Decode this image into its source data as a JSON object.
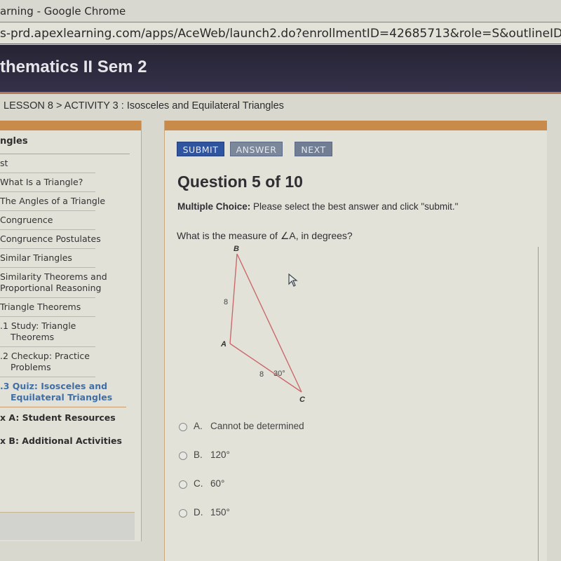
{
  "browser": {
    "window_title": "arning - Google Chrome",
    "url": "s-prd.apexlearning.com/apps/AceWeb/launch2.do?enrollmentID=42685713&role=S&outlineID=721505611&s"
  },
  "header": {
    "course_title": "thematics II  Sem 2"
  },
  "breadcrumb": {
    "text": "LESSON 8 > ACTIVITY 3 : Isosceles and Equilateral Triangles"
  },
  "sidebar": {
    "heading": "ngles",
    "items": [
      {
        "label": "st",
        "type": "item"
      },
      {
        "label": "What Is a Triangle?",
        "type": "item"
      },
      {
        "label": "The Angles of a Triangle",
        "type": "item"
      },
      {
        "label": "Congruence",
        "type": "item"
      },
      {
        "label": "Congruence Postulates",
        "type": "item"
      },
      {
        "label": "Similar Triangles",
        "type": "item"
      },
      {
        "label_line1": "Similarity Theorems and",
        "label_line2": "Proportional Reasoning",
        "type": "item"
      },
      {
        "label": "Triangle Theorems",
        "type": "item"
      },
      {
        "label_line1": ".1 Study: Triangle",
        "label_line2": "Theorems",
        "type": "sub"
      },
      {
        "label_line1": ".2 Checkup: Practice",
        "label_line2": "Problems",
        "type": "sub"
      },
      {
        "label_line1": ".3 Quiz: Isosceles and",
        "label_line2": "Equilateral Triangles",
        "type": "active"
      },
      {
        "label": "x A: Student Resources",
        "type": "appendix"
      },
      {
        "label": "x B: Additional Activities",
        "type": "appendix"
      }
    ]
  },
  "toolbar": {
    "submit_label": "SUBMIT",
    "answer_label": "ANSWER",
    "next_label": "NEXT"
  },
  "question": {
    "title": "Question 5 of 10",
    "instruction_type": "Multiple Choice:",
    "instruction_text": " Please select the best answer and click \"submit.\"",
    "prompt": "What is the measure of ∠A, in degrees?"
  },
  "figure": {
    "vertices": {
      "A": "A",
      "B": "B",
      "C": "C"
    },
    "side_AB": "8",
    "side_AC": "8",
    "angle_C": "30°",
    "line_color": "#c86a6a"
  },
  "choices": [
    {
      "letter": "A.",
      "text": "Cannot be determined",
      "selected": false
    },
    {
      "letter": "B.",
      "text": "120°",
      "selected": false
    },
    {
      "letter": "C.",
      "text": "60°",
      "selected": false
    },
    {
      "letter": "D.",
      "text": "150°",
      "selected": false
    }
  ]
}
